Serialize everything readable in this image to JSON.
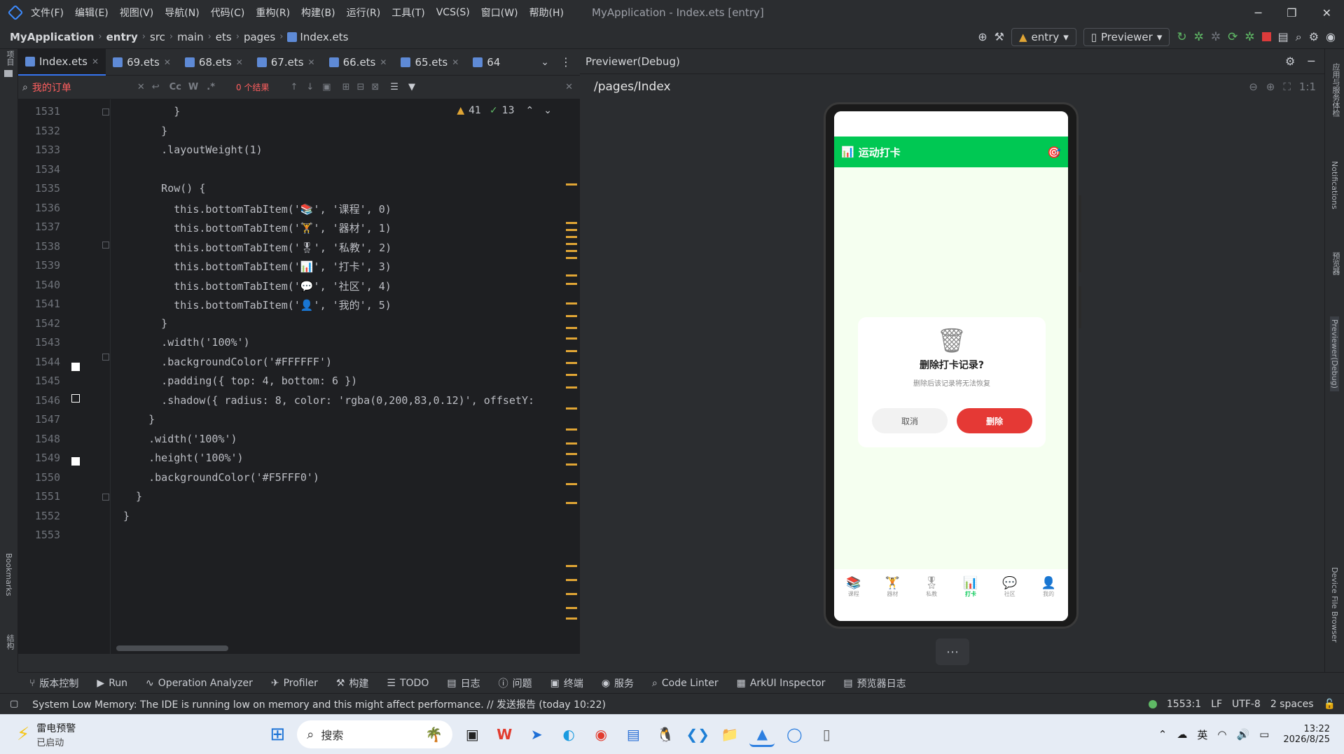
{
  "titlebar": {
    "menus": [
      "文件(F)",
      "编辑(E)",
      "视图(V)",
      "导航(N)",
      "代码(C)",
      "重构(R)",
      "构建(B)",
      "运行(R)",
      "工具(T)",
      "VCS(S)",
      "窗口(W)",
      "帮助(H)"
    ],
    "title": "MyApplication - Index.ets [entry]"
  },
  "navbar": {
    "breadcrumb": [
      "MyApplication",
      "entry",
      "src",
      "main",
      "ets",
      "pages",
      "Index.ets"
    ],
    "module": "entry",
    "device": "Previewer"
  },
  "tabs": [
    "Index.ets",
    "69.ets",
    "68.ets",
    "67.ets",
    "66.ets",
    "65.ets",
    "64"
  ],
  "search": {
    "query": "我的订单",
    "results": "0 个结果"
  },
  "inspections": {
    "warnings": "41",
    "ok": "13"
  },
  "code": {
    "lines": [
      {
        "n": "1531",
        "t": "        }"
      },
      {
        "n": "1532",
        "t": "      }"
      },
      {
        "n": "1533",
        "t": "      .layoutWeight(1)"
      },
      {
        "n": "1534",
        "t": ""
      },
      {
        "n": "1535",
        "t": "      Row() {"
      },
      {
        "n": "1536",
        "t": "        this.bottomTabItem('📚', '课程', 0)"
      },
      {
        "n": "1537",
        "t": "        this.bottomTabItem('🏋', '器材', 1)"
      },
      {
        "n": "1538",
        "t": "        this.bottomTabItem('🎖', '私教', 2)"
      },
      {
        "n": "1539",
        "t": "        this.bottomTabItem('📊', '打卡', 3)"
      },
      {
        "n": "1540",
        "t": "        this.bottomTabItem('💬', '社区', 4)"
      },
      {
        "n": "1541",
        "t": "        this.bottomTabItem('👤', '我的', 5)"
      },
      {
        "n": "1542",
        "t": "      }"
      },
      {
        "n": "1543",
        "t": "      .width('100%')"
      },
      {
        "n": "1544",
        "t": "      .backgroundColor('#FFFFFF')"
      },
      {
        "n": "1545",
        "t": "      .padding({ top: 4, bottom: 6 })"
      },
      {
        "n": "1546",
        "t": "      .shadow({ radius: 8, color: 'rgba(0,200,83,0.12)', offsetY:"
      },
      {
        "n": "1547",
        "t": "    }"
      },
      {
        "n": "1548",
        "t": "    .width('100%')"
      },
      {
        "n": "1549",
        "t": "    .height('100%')"
      },
      {
        "n": "1550",
        "t": "    .backgroundColor('#F5FFF0')"
      },
      {
        "n": "1551",
        "t": "  }"
      },
      {
        "n": "1552",
        "t": "}"
      },
      {
        "n": "1553",
        "t": ""
      }
    ]
  },
  "previewer": {
    "title": "Previewer(Debug)",
    "path": "/pages/Index",
    "app_title": "运动打卡",
    "dialog": {
      "title": "删除打卡记录?",
      "subtitle": "删除后该记录将无法恢复",
      "cancel": "取消",
      "confirm": "删除"
    },
    "bottom_tabs": [
      {
        "icon": "📚",
        "label": "课程"
      },
      {
        "icon": "🏋",
        "label": "器材"
      },
      {
        "icon": "🎖",
        "label": "私教"
      },
      {
        "icon": "📊",
        "label": "打卡"
      },
      {
        "icon": "💬",
        "label": "社区"
      },
      {
        "icon": "👤",
        "label": "我的"
      }
    ],
    "accent": "#00C853",
    "danger": "#E53935"
  },
  "left_strip": [
    "项目",
    "Bookmarks",
    "结构"
  ],
  "right_strip": [
    "应用与服务体检",
    "Notifications",
    "预览器",
    "Previewer(Debug)",
    "Device File Browser"
  ],
  "toolwindows": [
    "版本控制",
    "Run",
    "Operation Analyzer",
    "Profiler",
    "构建",
    "TODO",
    "日志",
    "问题",
    "终端",
    "服务",
    "Code Linter",
    "ArkUI Inspector",
    "预览器日志"
  ],
  "statusbar": {
    "message": "System Low Memory: The IDE is running low on memory and this might affect performance. // 发送报告 (today 10:22)",
    "position": "1553:1",
    "line_sep": "LF",
    "encoding": "UTF-8",
    "indent": "2 spaces"
  },
  "taskbar": {
    "weather_title": "雷电预警",
    "weather_sub": "已启动",
    "search": "搜索",
    "ime": "英",
    "time": "13:22",
    "date": "2026/8/25"
  }
}
